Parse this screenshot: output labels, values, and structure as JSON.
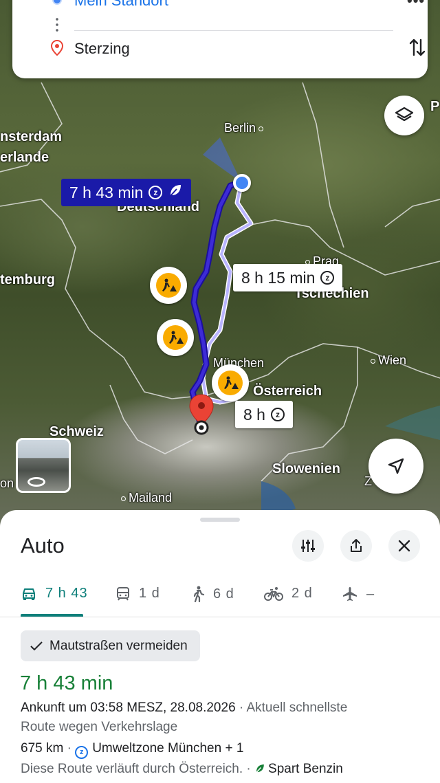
{
  "search": {
    "origin": "Mein Standort",
    "destination": "Sterzing",
    "more_icon": "more-horizontal-icon",
    "swap_icon": "swap-vertical-icon"
  },
  "map": {
    "countries": {
      "germany": "Deutschland",
      "czechia": "Tschechien",
      "austria": "Österreich",
      "switzerland": "Schweiz",
      "slovenia": "Slowenien",
      "netherlands": "erlande",
      "luxembourg": "temburg"
    },
    "cities": {
      "berlin": "Berlin",
      "prague": "Prag",
      "munich": "München",
      "vienna": "Wien",
      "milan": "Mailand",
      "amsterdam": "nsterdam",
      "p_edge": "P",
      "z_edge": "Z",
      "on_edge": "on"
    },
    "route_main": {
      "duration": "7 h 43 min",
      "color": "#1a1aa8"
    },
    "route_alt1": {
      "duration": "8 h 15 min"
    },
    "route_alt2": {
      "duration": "8 h"
    },
    "colors": {
      "route_primary": "#3d2bd6",
      "route_alt": "#b9b4ff",
      "warning": "#f9ab00"
    }
  },
  "sheet": {
    "title": "Auto",
    "tabs": [
      {
        "icon": "car-icon",
        "label": "7 h 43",
        "active": true
      },
      {
        "icon": "train-icon",
        "label": "1 d"
      },
      {
        "icon": "walk-icon",
        "label": "6 d"
      },
      {
        "icon": "bike-icon",
        "label": "2 d"
      },
      {
        "icon": "plane-icon",
        "label": "–"
      }
    ],
    "chip": "Mautstraßen vermeiden",
    "route_time": "7 h 43 min",
    "arrival": "Ankunft um 03:58 MESZ, 28.08.2026",
    "arrival_note": " · Aktuell schnellste",
    "arrival_note2": "Route wegen Verkehrslage",
    "distance": "675 km",
    "zone": "Umweltzone München + 1",
    "through": "Diese Route verläuft durch Österreich.",
    "fuel": "Spart Benzin",
    "accent": "#0d7f7a",
    "time_color": "#188038"
  }
}
